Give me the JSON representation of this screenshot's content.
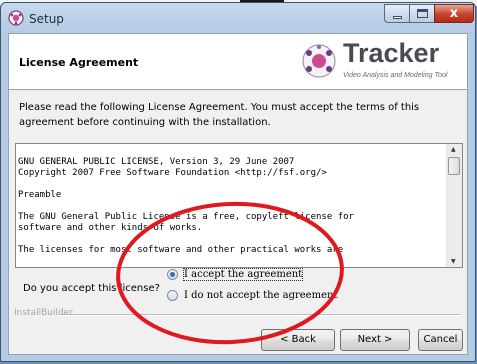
{
  "window": {
    "title": "Setup",
    "title_icon": "setup-app-icon"
  },
  "header": {
    "title": "License Agreement",
    "logo_name": "Tracker",
    "logo_tagline": "Video Analysis and Modeling Tool"
  },
  "intro_text": "Please read the following License Agreement. You must accept the terms of this agreement before continuing with the installation.",
  "license_lines": [
    "GNU GENERAL PUBLIC LICENSE, Version 3, 29 June 2007",
    "Copyright 2007 Free Software Foundation <http://fsf.org/>",
    "",
    "Preamble",
    "",
    "The GNU General Public License is a free, copyleft license for",
    "software and other kinds of works.",
    "",
    "The licenses for most software and other practical works are"
  ],
  "question": "Do you accept this license?",
  "options": [
    {
      "label": "I accept the agreement",
      "selected": true
    },
    {
      "label": "I do not accept the agreement",
      "selected": false
    }
  ],
  "footer_brand": "InstallBuilder",
  "buttons": {
    "back": "< Back",
    "next": "Next >",
    "cancel": "Cancel"
  },
  "colors": {
    "annotation": "#e0191f",
    "radio_selected": "#2f6fb5",
    "close_button": "#c7432c"
  }
}
